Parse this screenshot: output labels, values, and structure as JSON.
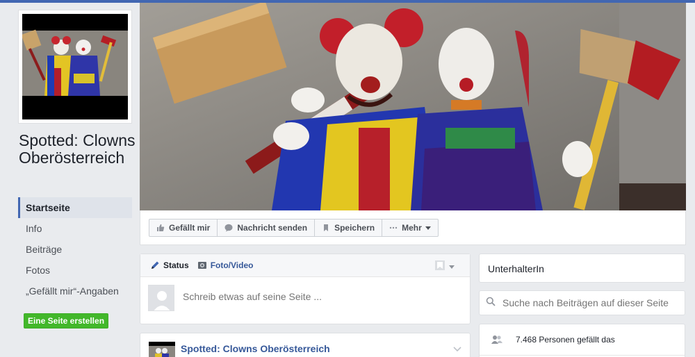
{
  "page": {
    "name": "Spotted: Clowns Oberösterreich"
  },
  "nav": {
    "items": [
      {
        "label": "Startseite",
        "active": true
      },
      {
        "label": "Info",
        "active": false
      },
      {
        "label": "Beiträge",
        "active": false
      },
      {
        "label": "Fotos",
        "active": false
      },
      {
        "label": "„Gefällt mir“-Angaben",
        "active": false
      }
    ],
    "create_page_label": "Eine Seite erstellen"
  },
  "actions": {
    "like_label": "Gefällt mir",
    "message_label": "Nachricht senden",
    "save_label": "Speichern",
    "more_label": "Mehr"
  },
  "composer": {
    "status_label": "Status",
    "photo_label": "Foto/Video",
    "placeholder": "Schreib etwas auf seine Seite ..."
  },
  "post": {
    "author": "Spotted: Clowns Oberösterreich"
  },
  "sidebar": {
    "category": "UnterhalterIn",
    "search_placeholder": "Suche nach Beiträgen auf dieser Seite",
    "likes_text": "7.468 Personen gefällt das"
  },
  "icons": {
    "like": "thumbs-up-icon",
    "message": "chat-bubble-icon",
    "save": "bookmark-icon",
    "more": "ellipsis-icon",
    "status": "pencil-icon",
    "photo": "camera-icon",
    "audience": "audience-icon",
    "search": "search-icon",
    "people": "people-icon",
    "chevron": "chevron-down-icon"
  },
  "colors": {
    "brand": "#4267b2",
    "link": "#365899",
    "create_button": "#42b72a",
    "background": "#e9ebee"
  }
}
